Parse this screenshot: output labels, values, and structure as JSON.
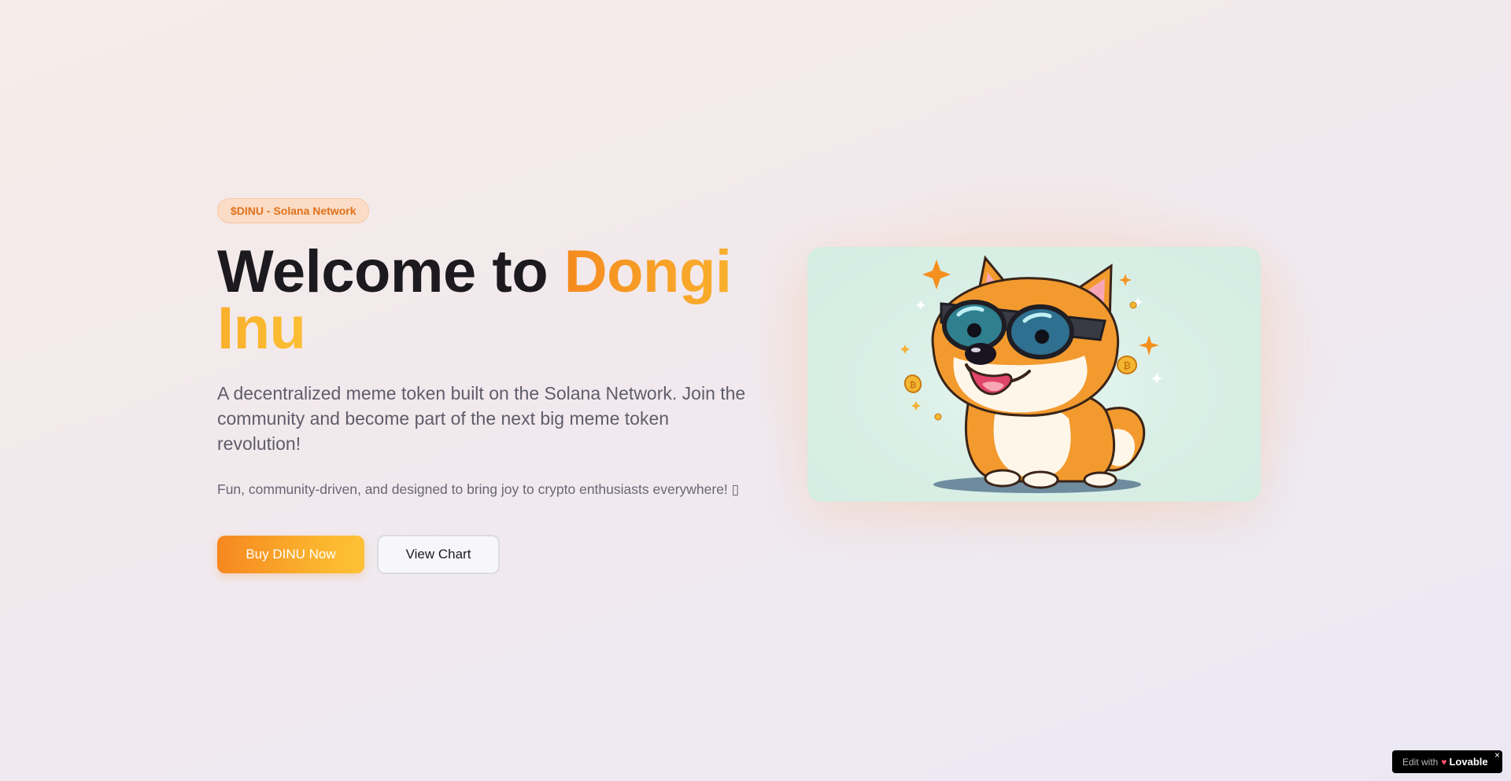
{
  "hero": {
    "badge": "$DINU - Solana Network",
    "title_prefix": "Welcome to ",
    "title_accent": "Dongi Inu",
    "lead": "A decentralized meme token built on the Solana Network. Join the community and become part of the next big meme token revolution!",
    "sub": "Fun, community-driven, and designed to bring joy to crypto enthusiasts everywhere! ▯",
    "primary_button": "Buy DINU Now",
    "secondary_button": "View Chart"
  },
  "mascot": {
    "icon": "shiba-inu-sunglasses-illustration"
  },
  "lovable_badge": {
    "edit_text": "Edit with",
    "brand": "Lovable",
    "close": "×"
  },
  "colors": {
    "accent_start": "#f58a1f",
    "accent_end": "#fdc136",
    "card_bg": "#d9efe6"
  }
}
